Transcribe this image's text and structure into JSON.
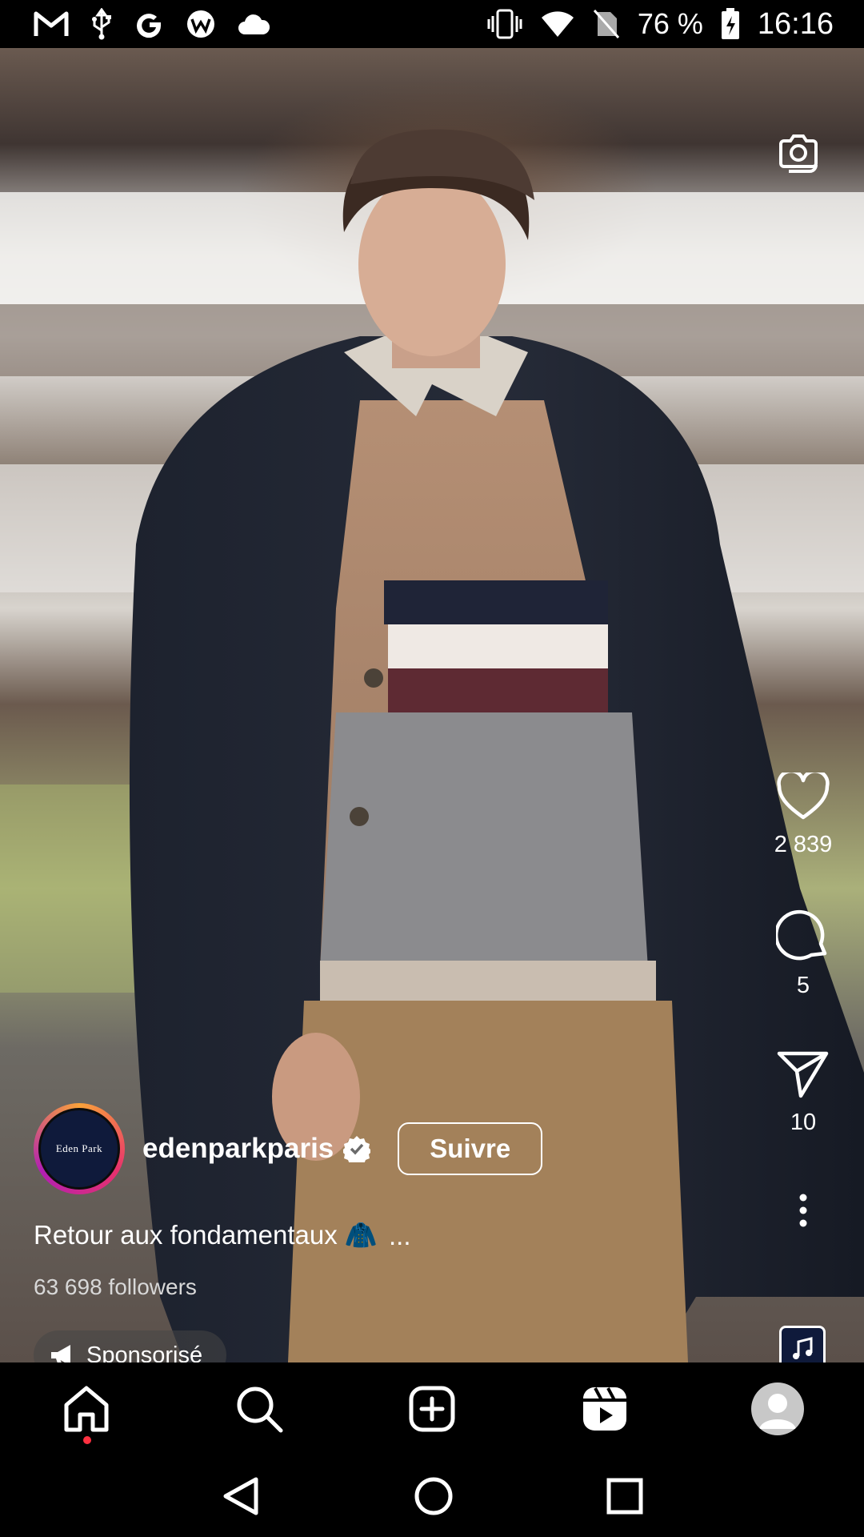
{
  "status_bar": {
    "left_icons": [
      "gmail-icon",
      "usb-icon",
      "google-icon",
      "vpn-icon",
      "cloud-icon"
    ],
    "right_icons": [
      "vibrate-icon",
      "wifi-icon",
      "no-sim-icon",
      "battery-charging-icon"
    ],
    "battery": "76 %",
    "time": "16:16"
  },
  "reel": {
    "author": {
      "username": "edenparkparis",
      "verified": true,
      "avatar_text": "Eden Park"
    },
    "follow_label": "Suivre",
    "caption": "Retour aux fondamentaux 🧥",
    "caption_more": "...",
    "followers": "63 698 followers",
    "sponsored_label": "Sponsorisé",
    "actions": {
      "likes": "2 839",
      "comments": "5",
      "shares": "10"
    }
  },
  "bottom_nav": {
    "items": [
      "home-icon",
      "search-icon",
      "create-icon",
      "reels-icon",
      "profile-icon"
    ]
  },
  "system_nav": {
    "items": [
      "back-icon",
      "home-circle-icon",
      "recents-icon"
    ]
  }
}
